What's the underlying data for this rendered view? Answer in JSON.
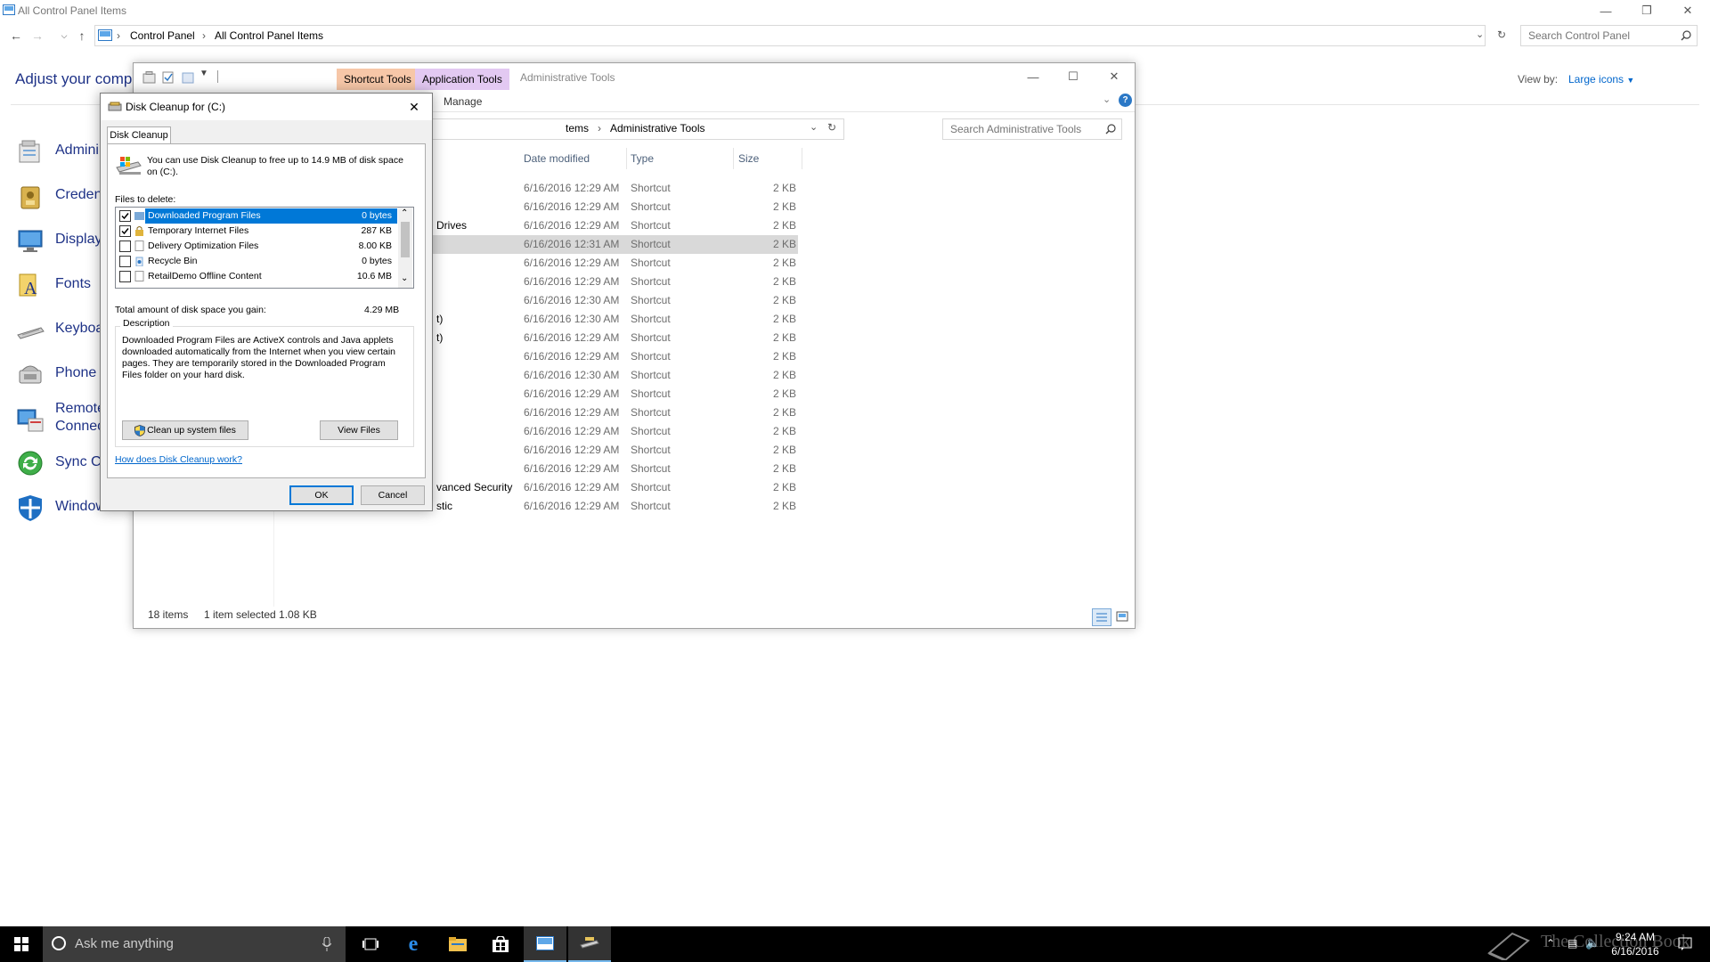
{
  "control_panel": {
    "window_title": "All Control Panel Items",
    "breadcrumb": [
      "Control Panel",
      "All Control Panel Items"
    ],
    "search_placeholder": "Search Control Panel",
    "heading": "Adjust your compu",
    "view_by_label": "View by:",
    "view_by_value": "Large icons",
    "items": [
      {
        "label": "Admini",
        "icon": "admin-tools-icon"
      },
      {
        "label": "Creden",
        "icon": "credential-manager-icon"
      },
      {
        "label": "Display",
        "icon": "display-icon"
      },
      {
        "label": "Fonts",
        "icon": "fonts-icon"
      },
      {
        "label": "Keyboa",
        "icon": "keyboard-icon"
      },
      {
        "label": "Phone",
        "icon": "phone-modem-icon"
      },
      {
        "label": "Remote",
        "label2": "Connec",
        "icon": "remoteapp-icon"
      },
      {
        "label": "Sync C",
        "icon": "sync-center-icon"
      },
      {
        "label": "Window",
        "icon": "windows-defender-icon"
      }
    ]
  },
  "admin_tools": {
    "title": "Administrative Tools",
    "context_tabs": [
      "Shortcut Tools",
      "Application Tools"
    ],
    "ribbon_tab": "Manage",
    "breadcrumb_prefix": "tems",
    "breadcrumb": "Administrative Tools",
    "search_placeholder": "Search Administrative Tools",
    "columns": [
      "Date modified",
      "Type",
      "Size"
    ],
    "rows": [
      {
        "name": "",
        "date": "6/16/2016 12:29 AM",
        "type": "Shortcut",
        "size": "2 KB"
      },
      {
        "name": "",
        "date": "6/16/2016 12:29 AM",
        "type": "Shortcut",
        "size": "2 KB"
      },
      {
        "name": "Drives",
        "date": "6/16/2016 12:29 AM",
        "type": "Shortcut",
        "size": "2 KB"
      },
      {
        "name": "",
        "date": "6/16/2016 12:31 AM",
        "type": "Shortcut",
        "size": "2 KB",
        "selected": true
      },
      {
        "name": "",
        "date": "6/16/2016 12:29 AM",
        "type": "Shortcut",
        "size": "2 KB"
      },
      {
        "name": "",
        "date": "6/16/2016 12:29 AM",
        "type": "Shortcut",
        "size": "2 KB"
      },
      {
        "name": "",
        "date": "6/16/2016 12:30 AM",
        "type": "Shortcut",
        "size": "2 KB"
      },
      {
        "name": "t)",
        "date": "6/16/2016 12:30 AM",
        "type": "Shortcut",
        "size": "2 KB"
      },
      {
        "name": "t)",
        "date": "6/16/2016 12:29 AM",
        "type": "Shortcut",
        "size": "2 KB"
      },
      {
        "name": "",
        "date": "6/16/2016 12:29 AM",
        "type": "Shortcut",
        "size": "2 KB"
      },
      {
        "name": "",
        "date": "6/16/2016 12:30 AM",
        "type": "Shortcut",
        "size": "2 KB"
      },
      {
        "name": "",
        "date": "6/16/2016 12:29 AM",
        "type": "Shortcut",
        "size": "2 KB"
      },
      {
        "name": "",
        "date": "6/16/2016 12:29 AM",
        "type": "Shortcut",
        "size": "2 KB"
      },
      {
        "name": "",
        "date": "6/16/2016 12:29 AM",
        "type": "Shortcut",
        "size": "2 KB"
      },
      {
        "name": "",
        "date": "6/16/2016 12:29 AM",
        "type": "Shortcut",
        "size": "2 KB"
      },
      {
        "name": "",
        "date": "6/16/2016 12:29 AM",
        "type": "Shortcut",
        "size": "2 KB"
      },
      {
        "name": "vanced Security",
        "date": "6/16/2016 12:29 AM",
        "type": "Shortcut",
        "size": "2 KB"
      },
      {
        "name": "stic",
        "date": "6/16/2016 12:29 AM",
        "type": "Shortcut",
        "size": "2 KB"
      }
    ],
    "status_count": "18 items",
    "status_selected": "1 item selected  1.08 KB"
  },
  "disk_cleanup": {
    "title": "Disk Cleanup for  (C:)",
    "tab": "Disk Cleanup",
    "intro": "You can use Disk Cleanup to free up to 14.9 MB of disk space on  (C:).",
    "files_label": "Files to delete:",
    "files": [
      {
        "name": "Downloaded Program Files",
        "size": "0 bytes",
        "checked": true,
        "selected": true
      },
      {
        "name": "Temporary Internet Files",
        "size": "287 KB",
        "checked": true
      },
      {
        "name": "Delivery Optimization Files",
        "size": "8.00 KB",
        "checked": false
      },
      {
        "name": "Recycle Bin",
        "size": "0 bytes",
        "checked": false
      },
      {
        "name": "RetailDemo Offline Content",
        "size": "10.6 MB",
        "checked": false
      }
    ],
    "total_label": "Total amount of disk space you gain:",
    "total_value": "4.29 MB",
    "description_label": "Description",
    "description": "Downloaded Program Files are ActiveX controls and Java applets downloaded automatically from the Internet when you view certain pages. They are temporarily stored in the Downloaded Program Files folder on your hard disk.",
    "cleanup_system_button": "Clean up system files",
    "view_files_button": "View Files",
    "help_link": "How does Disk Cleanup work?",
    "ok_button": "OK",
    "cancel_button": "Cancel"
  },
  "taskbar": {
    "search_placeholder": "Ask me anything",
    "time": "9:24 AM",
    "date": "6/16/2016",
    "watermark": "The Collection Book"
  },
  "colors": {
    "shortcut_tools_tab": "#f7c7a8",
    "application_tools_tab": "#e3c9f2",
    "selection_blue": "#0078d7",
    "link_blue": "#0066cc"
  }
}
